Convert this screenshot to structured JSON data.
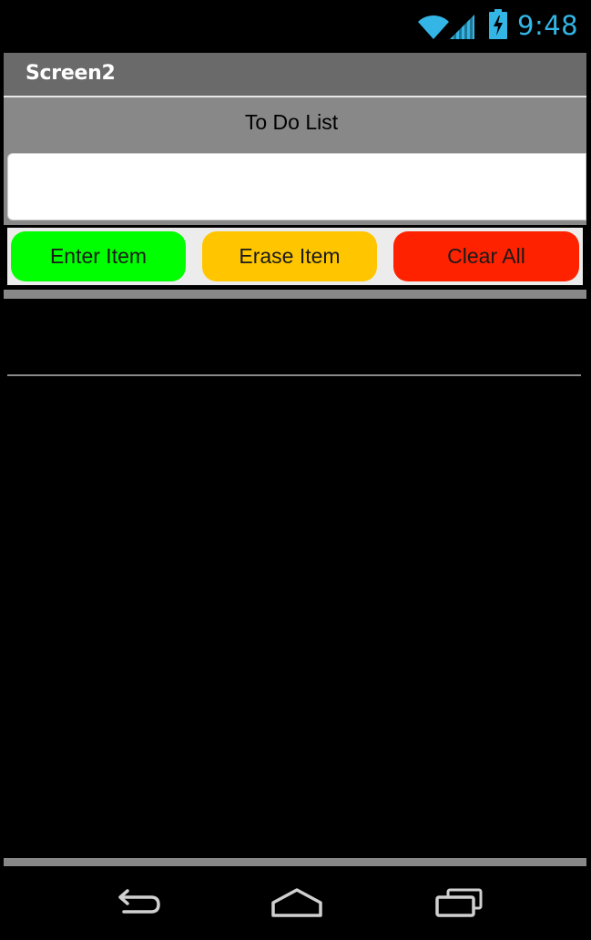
{
  "status_bar": {
    "time": "9:48",
    "icons": [
      "wifi-icon",
      "signal-icon",
      "battery-charging-icon"
    ],
    "accent_color": "#33b5e5"
  },
  "title_bar": {
    "title": "Screen2"
  },
  "header": {
    "label": "To Do List"
  },
  "input": {
    "value": "",
    "placeholder": ""
  },
  "buttons": {
    "enter": {
      "label": "Enter Item",
      "color": "#00ff00"
    },
    "erase": {
      "label": "Erase Item",
      "color": "#ffc600"
    },
    "clear": {
      "label": "Clear All",
      "color": "#ff2200"
    }
  },
  "list": {
    "items": []
  },
  "nav_bar": {
    "icons": [
      "back-icon",
      "home-icon",
      "recents-icon"
    ]
  }
}
